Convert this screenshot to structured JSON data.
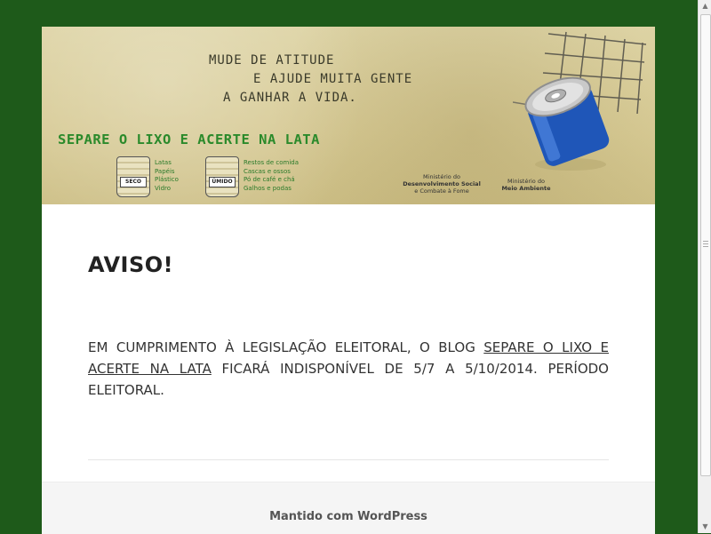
{
  "banner": {
    "slogan_lines": [
      "MUDE DE ATITUDE",
      "E AJUDE MUITA GENTE",
      "A GANHAR A VIDA."
    ],
    "campaign_title": "SEPARE O LIXO E ACERTE NA LATA",
    "bins": [
      {
        "tag": "SECO",
        "items": [
          "Latas",
          "Papéis",
          "Plástico",
          "Vidro"
        ]
      },
      {
        "tag": "ÚMIDO",
        "items": [
          "Restos de comida",
          "Cascas e ossos",
          "Pó de café e chá",
          "Galhos e podas"
        ]
      }
    ],
    "ministries": [
      {
        "line1": "Ministério do",
        "line2": "Desenvolvimento Social",
        "line3": "e Combate à Fome"
      },
      {
        "line1": "Ministério do",
        "line2": "Meio Ambiente",
        "line3": ""
      }
    ],
    "colors": {
      "campaign_green": "#2b8a2b",
      "can_blue": "#1f56b8"
    }
  },
  "post": {
    "title": "AVISO!",
    "text_before": "EM CUMPRIMENTO À LEGISLAÇÃO ELEITORAL, O BLOG ",
    "link_text": "SEPARE O LIXO E ACERTE NA LATA",
    "text_after": " FICARÁ INDISPONÍVEL DE 5/7 A 5/10/2014. PERÍODO ELEITORAL."
  },
  "footer": {
    "credit": "Mantido com WordPress"
  },
  "theme": {
    "background": "#1e5a1a"
  }
}
